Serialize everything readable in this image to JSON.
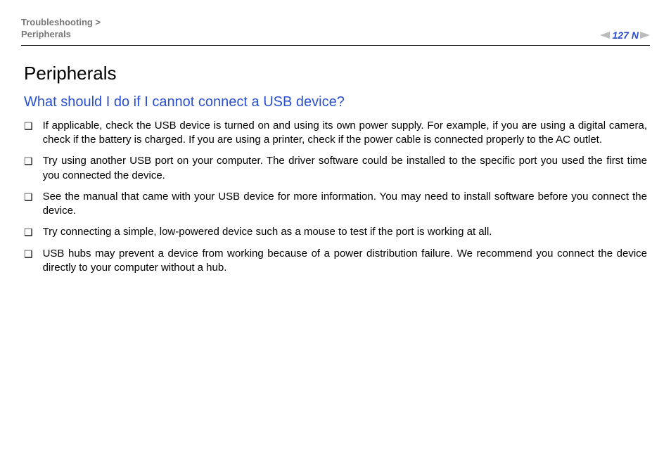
{
  "header": {
    "breadcrumb_line1": "Troubleshooting >",
    "breadcrumb_line2": "Peripherals",
    "page_number": "127"
  },
  "content": {
    "title": "Peripherals",
    "subhead": "What should I do if I cannot connect a USB device?",
    "bullets": [
      "If applicable, check the USB device is turned on and using its own power supply. For example, if you are using a digital camera, check if the battery is charged. If you are using a printer, check if the power cable is connected properly to the AC outlet.",
      "Try using another USB port on your computer. The driver software could be installed to the specific port you used the first time you connected the device.",
      "See the manual that came with your USB device for more information. You may need to install software before you connect the device.",
      "Try connecting a simple, low-powered device such as a mouse to test if the port is working at all.",
      "USB hubs may prevent a device from working because of a power distribution failure. We recommend you connect the device directly to your computer without a hub."
    ]
  }
}
